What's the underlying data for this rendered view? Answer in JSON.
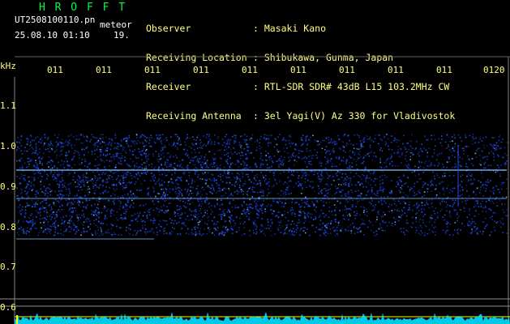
{
  "header": {
    "program": "H R O F F T",
    "filename": "UT2508100110.pn",
    "mode": "meteor",
    "datetime": "25.08.10 01:10",
    "counter": "19."
  },
  "station": {
    "labels": [
      "Observer",
      "Receiving Location",
      "Receiver",
      "Receiving Antenna"
    ],
    "values": [
      ": Masaki Kano",
      ": Shibukawa, Gunma, Japan",
      ": RTL-SDR SDR# 43dB L15 103.2MHz CW",
      ": 3el Yagi(V) Az 330 for Vladivostok"
    ]
  },
  "chart_data": {
    "type": "heatmap",
    "ylabel": "kHz",
    "y_ticks": [
      "1.1",
      "1.0",
      "0.9",
      "0.8",
      "0.7",
      "0.6"
    ],
    "x_ticks": [
      "011",
      "011",
      "011",
      "011",
      "011",
      "011",
      "011",
      "011",
      "011",
      "0120"
    ],
    "bands_khz": [
      0.94,
      0.87,
      0.77
    ],
    "noise_region_khz": [
      0.78,
      1.03
    ],
    "colors": {
      "background": "#000000",
      "signal": "#2050ff",
      "signal_bright": "#80c0ff",
      "footer_trace": "#00e0ff",
      "footer_line": "#ffff00",
      "ref_lines": "#909090"
    }
  }
}
